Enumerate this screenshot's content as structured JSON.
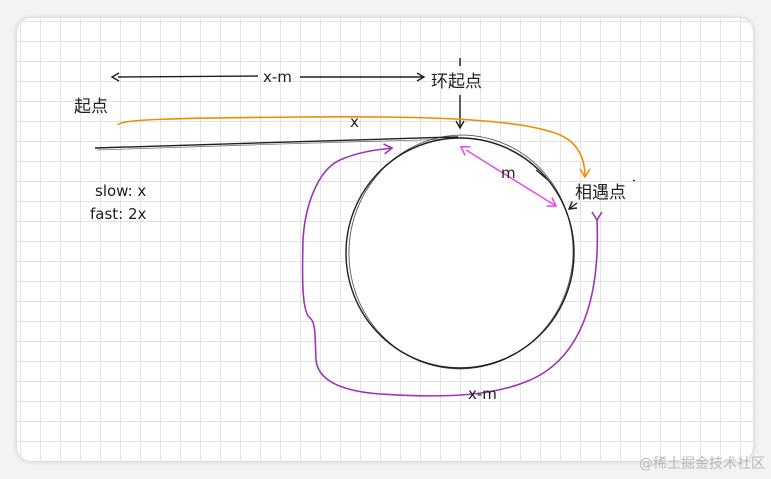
{
  "labels": {
    "top_span": "x-m",
    "loop_start": "环起点",
    "start": "起点",
    "x": "x",
    "m": "m",
    "meet_point": "相遇点",
    "slow": "slow: x",
    "fast": "fast: 2x",
    "bottom_span": "x-m"
  },
  "watermark": "@稀土掘金技术社区",
  "colors": {
    "ink": "#1e1e1e",
    "orange": "#f08c00",
    "purple": "#9c36b5",
    "magenta": "#e64ff0"
  }
}
